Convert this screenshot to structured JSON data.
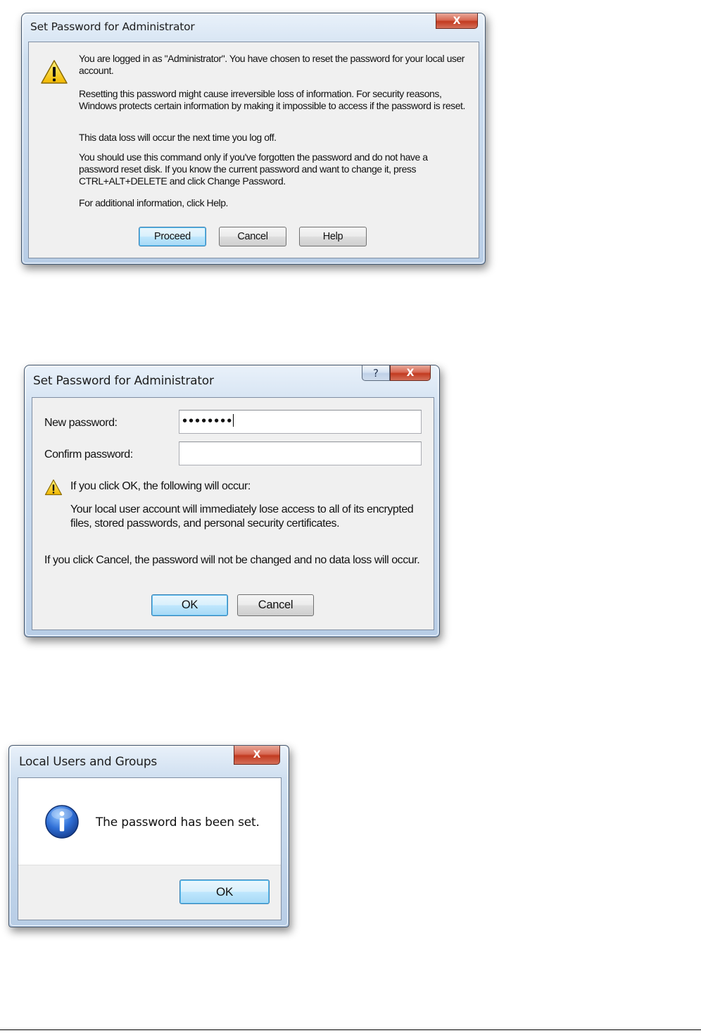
{
  "dialog1": {
    "title": "Set Password for Administrator",
    "close_glyph": "X",
    "icon": "warning-icon",
    "paragraphs": [
      "You are logged in as \"Administrator\". You have chosen to reset the password for your local user account.",
      "Resetting this password might cause irreversible loss of information. For security reasons, Windows protects certain information by making it impossible to access if the password is reset.",
      "This data loss will occur the next time you log off.",
      "You should use this command only if you've forgotten the password and do not have a password reset disk. If you know the current password and want to change it, press CTRL+ALT+DELETE and click Change Password.",
      "For additional information, click Help."
    ],
    "buttons": {
      "proceed": "Proceed",
      "cancel": "Cancel",
      "help": "Help"
    }
  },
  "dialog2": {
    "title": "Set Password for Administrator",
    "help_glyph": "?",
    "close_glyph": "X",
    "new_password_label": "New password:",
    "new_password_value": "••••••••",
    "confirm_password_label": "Confirm password:",
    "confirm_password_value": "",
    "warning_icon": "warning-icon",
    "warning_heading": "If you click OK, the following will occur:",
    "warning_detail": "Your local user account will immediately lose access to all of its encrypted files, stored passwords, and personal security certificates.",
    "cancel_note": "If you click Cancel, the password will not be changed and no data loss will occur.",
    "buttons": {
      "ok": "OK",
      "cancel": "Cancel"
    }
  },
  "dialog3": {
    "title": "Local Users and Groups",
    "close_glyph": "X",
    "icon": "info-icon",
    "message": "The password has been set.",
    "buttons": {
      "ok": "OK"
    }
  }
}
